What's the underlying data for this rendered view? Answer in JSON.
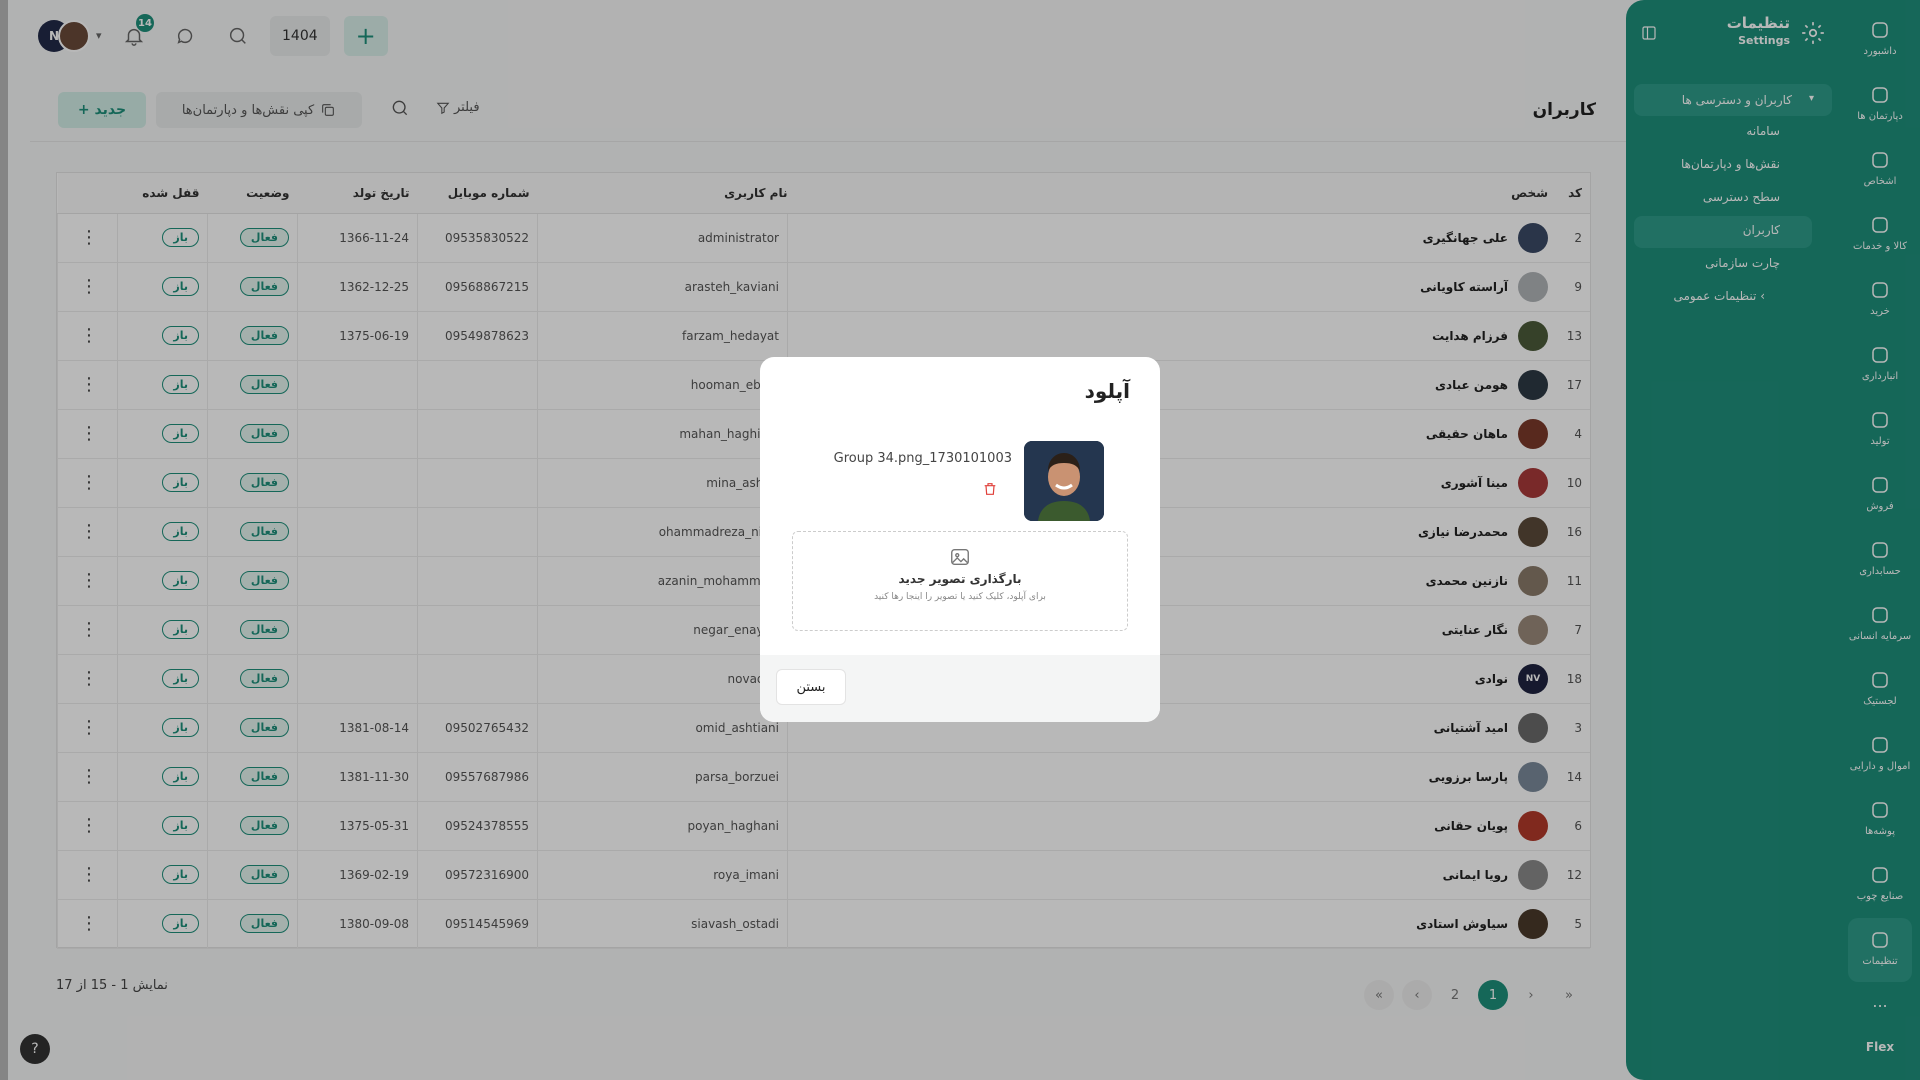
{
  "header": {
    "avatar_initials": "N",
    "notification_count": "14",
    "year": "1404"
  },
  "page": {
    "title": "کاربران",
    "new_button": "+ جدید",
    "copy_button": "کپی نقش‌ها و دپارتمان‌ها",
    "filter_button": "فیلتر"
  },
  "table": {
    "columns": [
      "کد",
      "شخص",
      "نام کاربری",
      "شماره موبایل",
      "تاریخ تولد",
      "وضعیت",
      "قفل شده"
    ],
    "rows": [
      {
        "code": "2",
        "name": "علی جهانگیری",
        "username": "administrator",
        "mobile": "09535830522",
        "birth": "1366-11-24",
        "status": "فعال",
        "lock": "باز"
      },
      {
        "code": "9",
        "name": "آراسته کاویانی",
        "username": "arasteh_kaviani",
        "mobile": "09568867215",
        "birth": "1362-12-25",
        "status": "فعال",
        "lock": "باز"
      },
      {
        "code": "13",
        "name": "فرزام هدایت",
        "username": "farzam_hedayat",
        "mobile": "09549878623",
        "birth": "1375-06-19",
        "status": "فعال",
        "lock": "باز"
      },
      {
        "code": "17",
        "name": "هومن عبادی",
        "username": "hooman_ebadi",
        "mobile": "",
        "birth": "",
        "status": "فعال",
        "lock": "باز"
      },
      {
        "code": "4",
        "name": "ماهان حقیقی",
        "username": "mahan_haghighi",
        "mobile": "",
        "birth": "",
        "status": "فعال",
        "lock": "باز"
      },
      {
        "code": "10",
        "name": "مینا آشوری",
        "username": "mina_ashori",
        "mobile": "",
        "birth": "",
        "status": "فعال",
        "lock": "باز"
      },
      {
        "code": "16",
        "name": "محمدرضا نیازی",
        "username": "ohammadreza_niazi",
        "mobile": "",
        "birth": "",
        "status": "فعال",
        "lock": "باز"
      },
      {
        "code": "11",
        "name": "نازنین محمدی",
        "username": "azanin_mohammadi",
        "mobile": "",
        "birth": "",
        "status": "فعال",
        "lock": "باز"
      },
      {
        "code": "7",
        "name": "نگار عنایتی",
        "username": "negar_enayati",
        "mobile": "",
        "birth": "",
        "status": "فعال",
        "lock": "باز"
      },
      {
        "code": "18",
        "name": "نوادی",
        "username": "novaday",
        "mobile": "",
        "birth": "",
        "status": "فعال",
        "lock": "باز"
      },
      {
        "code": "3",
        "name": "امید آشتیانی",
        "username": "omid_ashtiani",
        "mobile": "09502765432",
        "birth": "1381-08-14",
        "status": "فعال",
        "lock": "باز"
      },
      {
        "code": "14",
        "name": "پارسا برزویی",
        "username": "parsa_borzuei",
        "mobile": "09557687986",
        "birth": "1381-11-30",
        "status": "فعال",
        "lock": "باز"
      },
      {
        "code": "6",
        "name": "پویان حقانی",
        "username": "poyan_haghani",
        "mobile": "09524378555",
        "birth": "1375-05-31",
        "status": "فعال",
        "lock": "باز"
      },
      {
        "code": "12",
        "name": "رویا ایمانی",
        "username": "roya_imani",
        "mobile": "09572316900",
        "birth": "1369-02-19",
        "status": "فعال",
        "lock": "باز"
      },
      {
        "code": "5",
        "name": "سیاوش استادی",
        "username": "siavash_ostadi",
        "mobile": "09514545969",
        "birth": "1380-09-08",
        "status": "فعال",
        "lock": "باز"
      }
    ]
  },
  "footer": {
    "showing": "نمایش 1 - 15 از 17",
    "pages": [
      "2",
      "1"
    ],
    "help": "?"
  },
  "sidebar": {
    "title": "تنظیمات",
    "subtitle": "Settings",
    "group": "کاربران و دسترسی ها",
    "items": [
      "سامانه",
      "نقش‌ها و دپارتمان‌ها",
      "سطح دسترسی",
      "کاربران",
      "چارت سازمانی",
      "تنظیمات عمومی"
    ]
  },
  "rail": {
    "items": [
      "داشبورد",
      "دپارتمان ها",
      "اشخاص",
      "کالا و خدمات",
      "خرید",
      "انبارداری",
      "تولید",
      "فروش",
      "حسابداری",
      "سرمایه انسانی",
      "لجستیک",
      "اموال و دارایی",
      "پوشه‌ها",
      "صنایع چوب",
      "تنظیمات"
    ],
    "more": "...",
    "brand": "Flex"
  },
  "modal": {
    "title": "آپلود",
    "filename": "Group 34.png_1730101003",
    "upload_title": "بارگذاری تصویر جدید",
    "upload_hint": "برای آپلود، کلیک کنید یا تصویر را اینجا رها کنید",
    "close_button": "بستن"
  }
}
